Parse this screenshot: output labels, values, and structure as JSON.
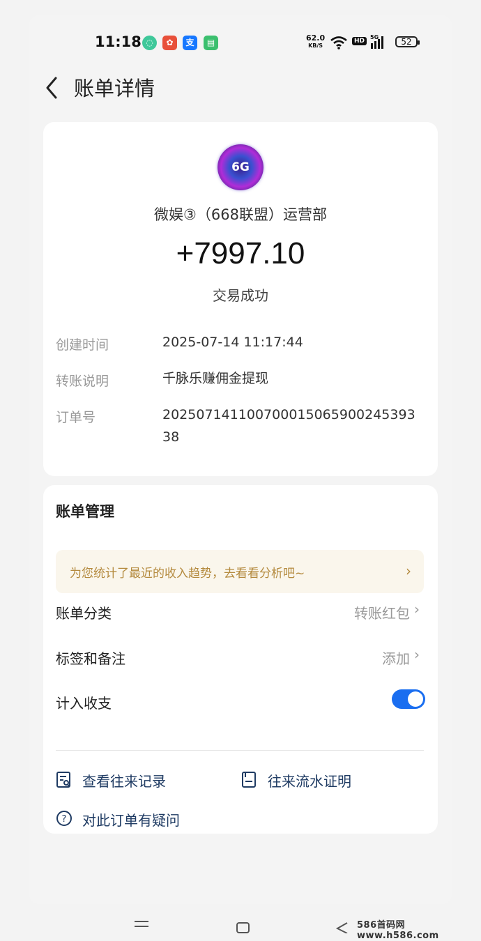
{
  "status_bar": {
    "time": "11:18",
    "net_speed": "62.0",
    "net_speed_unit": "KB/S",
    "hd": "HD",
    "signal": "5G",
    "battery": "52"
  },
  "header": {
    "title": "账单详情"
  },
  "transaction": {
    "avatar_text": "6G",
    "payee": "微娱③（668联盟）运营部",
    "amount": "+7997.10",
    "status": "交易成功",
    "details": [
      {
        "label": "创建时间",
        "value": "2025-07-14 11:17:44"
      },
      {
        "label": "转账说明",
        "value": "千脉乐赚佣金提现"
      },
      {
        "label": "订单号",
        "value": "20250714110070001506590024539338"
      }
    ]
  },
  "bill_manage": {
    "title": "账单管理",
    "tip": "为您统计了最近的收入趋势，去看看分析吧~",
    "category_label": "账单分类",
    "category_value": "转账红包",
    "tags_label": "标签和备注",
    "tags_value": "添加",
    "count_label": "计入收支",
    "count_enabled": true,
    "links": {
      "records": "查看往来记录",
      "proof": "往来流水证明",
      "question": "对此订单有疑问"
    }
  },
  "watermark": "586首码网 www.h586.com",
  "colors": {
    "accent": "#1a6ef0",
    "tip_text": "#b48a3e",
    "tip_bg": "#faf6ec",
    "link": "#1f3b63"
  }
}
